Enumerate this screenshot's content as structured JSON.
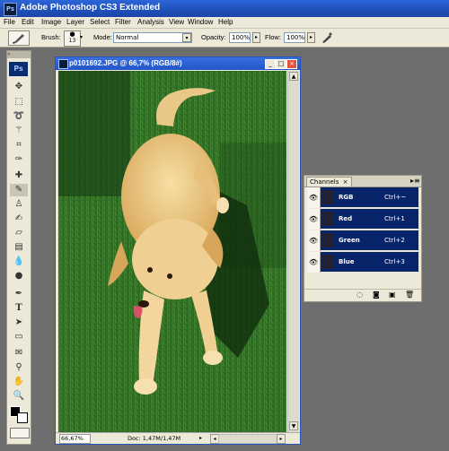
{
  "app": {
    "title": "Adobe Photoshop CS3 Extended",
    "logo": "Ps"
  },
  "menu": [
    "File",
    "Edit",
    "Image",
    "Layer",
    "Select",
    "Filter",
    "Analysis",
    "View",
    "Window",
    "Help"
  ],
  "options": {
    "brush_label": "Brush:",
    "brush_size": "13",
    "mode_label": "Mode:",
    "mode_value": "Normal",
    "opacity_label": "Opacity:",
    "opacity_value": "100%",
    "flow_label": "Flow:",
    "flow_value": "100%"
  },
  "document": {
    "title": "p0101692.JPG @ 66,7% (RGB/8#)",
    "zoom": "66,67%",
    "doc_info": "Doc: 1,47M/1,47M"
  },
  "channels": {
    "tab_label": "Channels",
    "items": [
      {
        "name": "RGB",
        "shortcut": "Ctrl+~"
      },
      {
        "name": "Red",
        "shortcut": "Ctrl+1"
      },
      {
        "name": "Green",
        "shortcut": "Ctrl+2"
      },
      {
        "name": "Blue",
        "shortcut": "Ctrl+3"
      }
    ]
  },
  "colors": {
    "selection": "#0a246a",
    "titlebar": "#1f4fb8",
    "workspace": "#6e6e6e"
  }
}
